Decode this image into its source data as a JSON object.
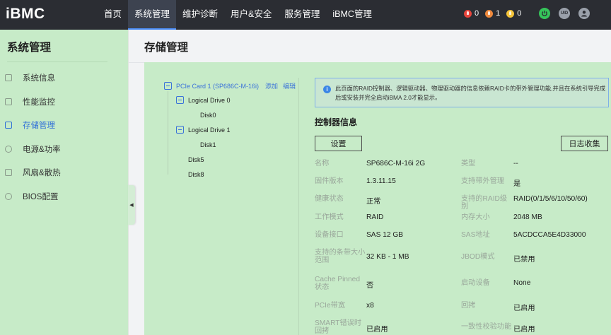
{
  "app": {
    "logo": "iBMC"
  },
  "nav": {
    "items": [
      {
        "label": "首页"
      },
      {
        "label": "系统管理"
      },
      {
        "label": "维护诊断"
      },
      {
        "label": "用户&安全"
      },
      {
        "label": "服务管理"
      },
      {
        "label": "iBMC管理"
      }
    ],
    "active": "系统管理"
  },
  "alerts": [
    {
      "count": "0",
      "color": "#e8453c",
      "icon": "critical-alert-icon"
    },
    {
      "count": "1",
      "color": "#f08a3e",
      "icon": "major-alert-icon"
    },
    {
      "count": "0",
      "color": "#f5c43a",
      "icon": "minor-alert-icon"
    }
  ],
  "top_icons": [
    {
      "icon": "power-icon",
      "color": "#35c45a",
      "text": ""
    },
    {
      "icon": "uid-icon",
      "color": "#9aa0aa",
      "text": "UID"
    },
    {
      "icon": "user-icon",
      "color": "#9aa0aa",
      "text": ""
    }
  ],
  "sidebar": {
    "title": "系统管理",
    "items": [
      {
        "label": "系统信息",
        "icon": "system-info-icon"
      },
      {
        "label": "性能监控",
        "icon": "performance-icon"
      },
      {
        "label": "存储管理",
        "icon": "storage-icon"
      },
      {
        "label": "电源&功率",
        "icon": "power-supply-icon"
      },
      {
        "label": "风扇&散热",
        "icon": "fan-icon"
      },
      {
        "label": "BIOS配置",
        "icon": "bios-icon"
      }
    ],
    "active": "存储管理"
  },
  "page": {
    "title": "存储管理"
  },
  "tree": {
    "root_label": "PCIe Card 1 (SP686C-M-16i)",
    "add_label": "添加",
    "edit_label": "编辑",
    "nodes": [
      {
        "label": "Logical Drive 0",
        "expandable": true
      },
      {
        "label": "Disk0",
        "expandable": false
      },
      {
        "label": "Logical Drive 1",
        "expandable": true
      },
      {
        "label": "Disk1",
        "expandable": false
      },
      {
        "label": "Disk5",
        "expandable": false
      },
      {
        "label": "Disk8",
        "expandable": false
      }
    ]
  },
  "info": {
    "text": "此页面的RAID控制器、逻辑驱动器、物理驱动器的信息依赖RAID卡的带外管理功能,并且在系统引导完成后或安装并完全启动iBMA 2.0才能显示。"
  },
  "controller": {
    "section_title": "控制器信息",
    "settings_button": "设置",
    "log_button": "日志收集",
    "left": [
      {
        "label": "名称",
        "value": "SP686C-M-16i 2G"
      },
      {
        "label": "固件版本",
        "value": "1.3.11.15"
      },
      {
        "label": "健康状态",
        "value": "正常"
      },
      {
        "label": "工作模式",
        "value": "RAID"
      },
      {
        "label": "设备接口",
        "value": "SAS 12 GB"
      },
      {
        "label": "支持的条带大小范围",
        "value": "32 KB - 1 MB"
      },
      {
        "label": "Cache Pinned状态",
        "value": "否"
      },
      {
        "label": "PCIe带宽",
        "value": "x8"
      },
      {
        "label": "SMART错误时回拷",
        "value": "已启用"
      }
    ],
    "right": [
      {
        "label": "类型",
        "value": "--"
      },
      {
        "label": "支持带外管理",
        "value": "是"
      },
      {
        "label": "支持的RAID级别",
        "value": "RAID(0/1/5/6/10/50/60)"
      },
      {
        "label": "内存大小",
        "value": "2048 MB"
      },
      {
        "label": "SAS地址",
        "value": "5ACDCCA5E4D33000"
      },
      {
        "label": "JBOD模式",
        "value": "已禁用"
      },
      {
        "label": "启动设备",
        "value": "None"
      },
      {
        "label": "回拷",
        "value": "已启用"
      },
      {
        "label": "一致性校验功能",
        "value": "已启用"
      }
    ]
  }
}
